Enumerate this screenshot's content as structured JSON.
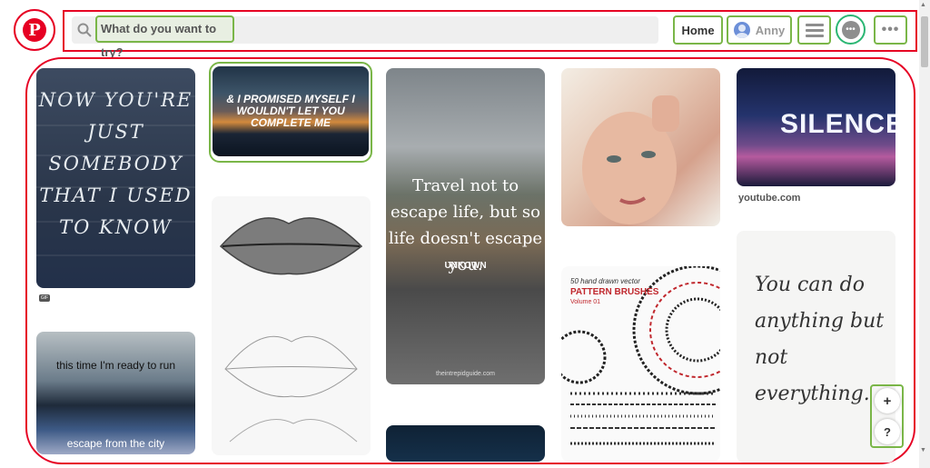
{
  "header": {
    "search_placeholder": "What do you want to try?",
    "home_label": "Home",
    "user_name": "Anny",
    "more_label": "•••"
  },
  "pins": [
    {
      "id": "pin-quote-now",
      "text": "NOW YOU'RE JUST SOMEBODY THAT I USED TO KNOW",
      "badge": "GIF"
    },
    {
      "id": "pin-ready-to-run",
      "text_top": "this time I'm ready to run",
      "text_bottom": "escape from the city"
    },
    {
      "id": "pin-promised-myself",
      "text": "& I PROMISED MYSELF I WOULDN'T LET YOU COMPLETE ME"
    },
    {
      "id": "pin-lips-drawing",
      "text": ""
    },
    {
      "id": "pin-travel-quote",
      "text": "Travel not to escape life, but so life doesn't escape you.",
      "author": "UNKOWN",
      "source": "theintrepidguide.com"
    },
    {
      "id": "pin-selfie",
      "text": ""
    },
    {
      "id": "pin-pattern-brushes",
      "line1": "50 hand drawn vector",
      "line2": "PATTERN BRUSHES",
      "line3": "Volume 01"
    },
    {
      "id": "pin-silence",
      "text": "SILENCE",
      "caption": "youtube.com"
    },
    {
      "id": "pin-you-can-do",
      "text": "You can do anything but not everything."
    }
  ],
  "floating": {
    "add_label": "+",
    "help_label": "?"
  },
  "colors": {
    "brand": "#e60023",
    "highlight": "#7ab648"
  }
}
